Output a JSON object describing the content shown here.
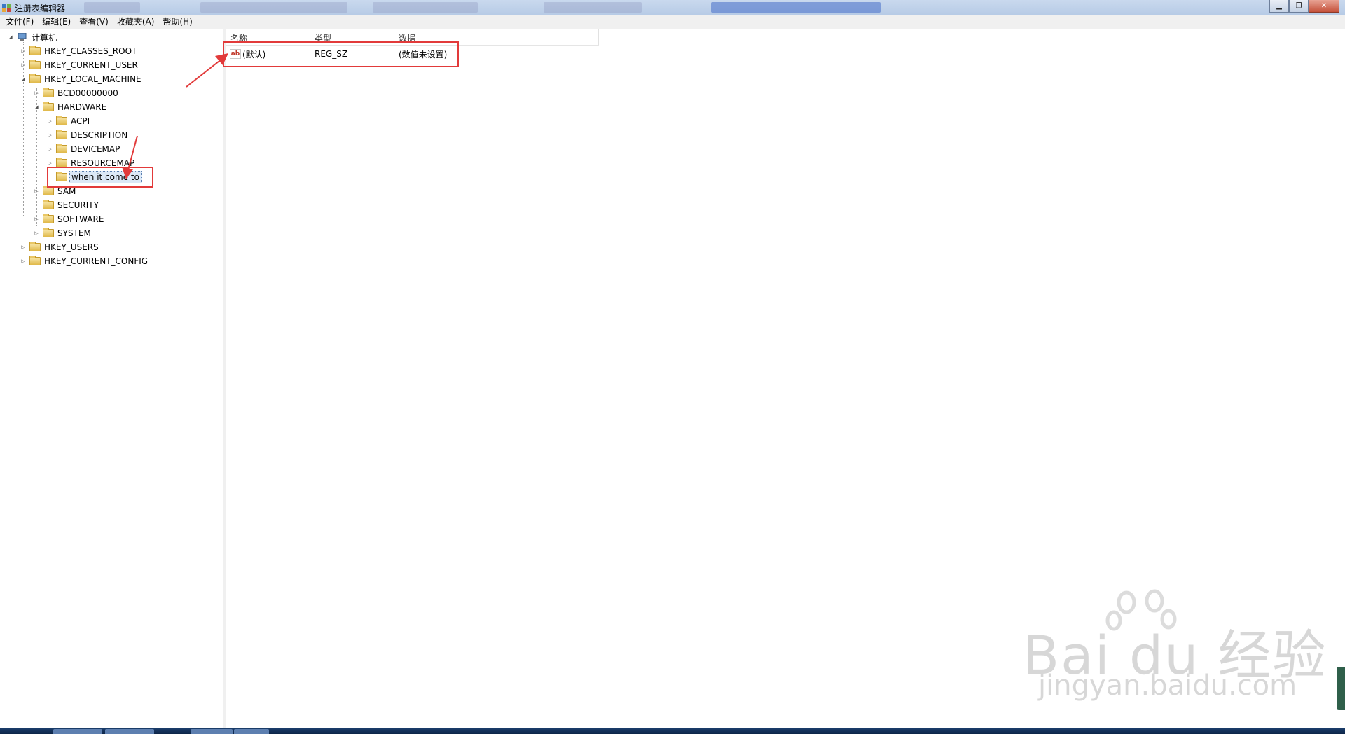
{
  "window": {
    "title": "注册表编辑器"
  },
  "menu": {
    "items": [
      "文件(F)",
      "编辑(E)",
      "查看(V)",
      "收藏夹(A)",
      "帮助(H)"
    ]
  },
  "tree": {
    "root": "计算机",
    "nodes": [
      {
        "label": "HKEY_CLASSES_ROOT"
      },
      {
        "label": "HKEY_CURRENT_USER"
      },
      {
        "label": "HKEY_LOCAL_MACHINE"
      },
      {
        "label": "BCD00000000"
      },
      {
        "label": "HARDWARE"
      },
      {
        "label": "ACPI"
      },
      {
        "label": "DESCRIPTION"
      },
      {
        "label": "DEVICEMAP"
      },
      {
        "label": "RESOURCEMAP"
      },
      {
        "label": "when it come to"
      },
      {
        "label": "SAM"
      },
      {
        "label": "SECURITY"
      },
      {
        "label": "SOFTWARE"
      },
      {
        "label": "SYSTEM"
      },
      {
        "label": "HKEY_USERS"
      },
      {
        "label": "HKEY_CURRENT_CONFIG"
      }
    ]
  },
  "list": {
    "columns": [
      "名称",
      "类型",
      "数据"
    ],
    "rows": [
      {
        "name": "(默认)",
        "type": "REG_SZ",
        "data": "(数值未设置)"
      }
    ]
  },
  "watermark": {
    "main": "Bai du 经验",
    "sub": "jingyan.baidu.com"
  },
  "colors": {
    "annotation": "#e23a3a",
    "selection": "#dbe8f7"
  }
}
